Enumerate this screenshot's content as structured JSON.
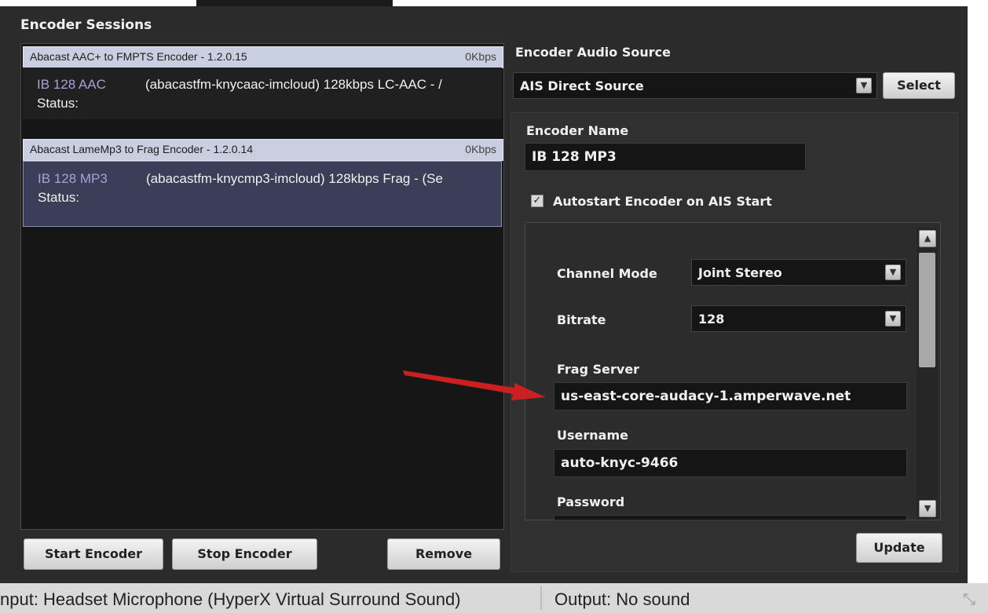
{
  "app": {
    "sessions_title": "Encoder Sessions"
  },
  "sessions": [
    {
      "header": "Abacast AAC+ to FMPTS Encoder - 1.2.0.15",
      "rate": "0Kbps",
      "encoder": "IB 128 AAC",
      "description": "(abacastfm-knycaac-imcloud) 128kbps LC-AAC - /",
      "status_label": "Status:",
      "body_color": "#202020"
    },
    {
      "header": "Abacast LameMp3 to Frag Encoder - 1.2.0.14",
      "rate": "0Kbps",
      "encoder": "IB 128 MP3",
      "description": "(abacastfm-knycmp3-imcloud) 128kbps Frag - (Se",
      "status_label": "Status:",
      "body_color": "#3b3e57"
    }
  ],
  "buttons": {
    "start": "Start Encoder",
    "stop": "Stop Encoder",
    "remove": "Remove",
    "select": "Select",
    "update": "Update"
  },
  "audio_source": {
    "label": "Encoder Audio Source",
    "value": "AIS Direct Source"
  },
  "encoder_name": {
    "label": "Encoder Name",
    "value": "IB 128 MP3"
  },
  "autostart": {
    "label": "Autostart Encoder on AIS Start",
    "checked": true
  },
  "settings": {
    "channel_mode": {
      "label": "Channel Mode",
      "value": "Joint Stereo"
    },
    "bitrate": {
      "label": "Bitrate",
      "value": "128"
    },
    "frag_server": {
      "label": "Frag Server",
      "value": "us-east-core-audacy-1.amperwave.net"
    },
    "username": {
      "label": "Username",
      "value": "auto-knyc-9466"
    },
    "password": {
      "label": "Password",
      "value": ""
    }
  },
  "statusbar": {
    "input": "nput: Headset Microphone (HyperX Virtual Surround Sound)",
    "output": "Output: No sound"
  },
  "colors": {
    "arrow": "#cc1f1f",
    "selected_row": "#3b3e57",
    "header_row": "#c9cfe0"
  }
}
